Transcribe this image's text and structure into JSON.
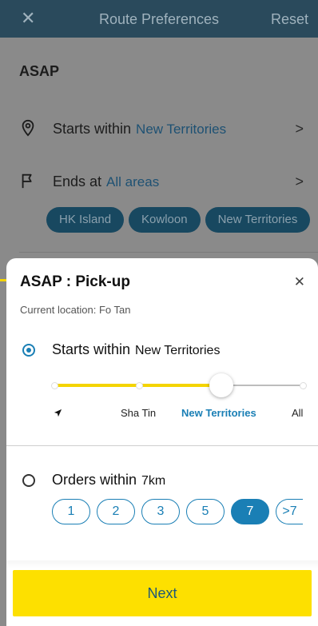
{
  "header": {
    "close_glyph": "✕",
    "title": "Route Preferences",
    "reset_label": "Reset"
  },
  "background": {
    "section_title": "ASAP",
    "starts_row": {
      "label": "Starts within",
      "value": "New Territories",
      "icon": "location-pin-icon"
    },
    "ends_row": {
      "label": "Ends at",
      "value": "All areas",
      "icon": "flag-icon"
    },
    "chevron": ">",
    "area_chips": [
      "HK Island",
      "Kowloon",
      "New Territories"
    ]
  },
  "sheet": {
    "title": "ASAP : Pick-up",
    "close_glyph": "✕",
    "current_location": "Current location: Fo Tan",
    "starts_option": {
      "label": "Starts within",
      "value": "New Territories",
      "selected": true
    },
    "slider": {
      "stops": [
        "",
        "Sha Tin",
        "New Territories",
        "All"
      ],
      "selected_stop": "New Territories",
      "first_stop_icon": "navigation-arrow-icon"
    },
    "orders_option": {
      "label": "Orders within",
      "value": "7km",
      "selected": false
    },
    "distance_pills": [
      "1",
      "2",
      "3",
      "5",
      "7",
      ">7"
    ],
    "selected_distance": "7",
    "next_label": "Next"
  },
  "colors": {
    "accent_blue": "#1a7fb5",
    "accent_yellow": "#fde000",
    "header_bg": "#2a4a5c"
  }
}
